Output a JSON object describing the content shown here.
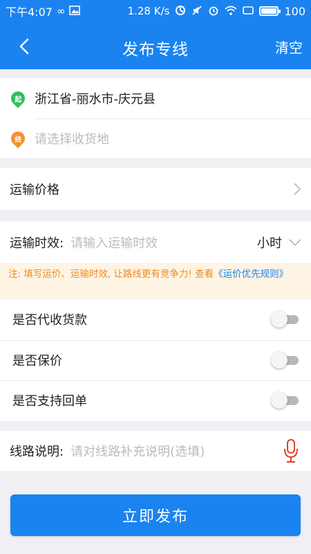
{
  "status_bar": {
    "time": "下午4:07",
    "network_speed": "1.28 K/s",
    "battery": "100",
    "battery_level": 1.0,
    "icons": [
      "infinity-icon",
      "image-icon",
      "sync-icon",
      "mute-icon",
      "alarm-icon",
      "wifi-icon",
      "screen-icon",
      "battery-icon"
    ]
  },
  "header": {
    "title": "发布专线",
    "clear_label": "清空",
    "background_color": "#1a83f0"
  },
  "route": {
    "origin_badge": "起",
    "origin": "浙江省-丽水市-庆元县",
    "destination_badge": "终",
    "destination_placeholder": "请选择收货地"
  },
  "price": {
    "label": "运输价格"
  },
  "transit_time": {
    "label": "运输时效:",
    "placeholder": "请输入运输时效",
    "unit": "小时"
  },
  "notice": {
    "text": "注: 填写运价、运输时效, 让路线更有竞争力! 查看",
    "link": "《运价优先规则》"
  },
  "toggles": [
    {
      "label": "是否代收货款",
      "enabled": false
    },
    {
      "label": "是否保价",
      "enabled": false
    },
    {
      "label": "是否支持回单",
      "enabled": false
    }
  ],
  "description": {
    "label": "线路说明:",
    "placeholder": "请对线路补充说明(选填)"
  },
  "publish_button": {
    "label": "立即发布"
  },
  "colors": {
    "accent": "#1a83f0",
    "origin_pin": "#2fbf5e",
    "destination_pin": "#f5912f",
    "notice_text": "#f08a24",
    "mic": "#e0402a"
  }
}
